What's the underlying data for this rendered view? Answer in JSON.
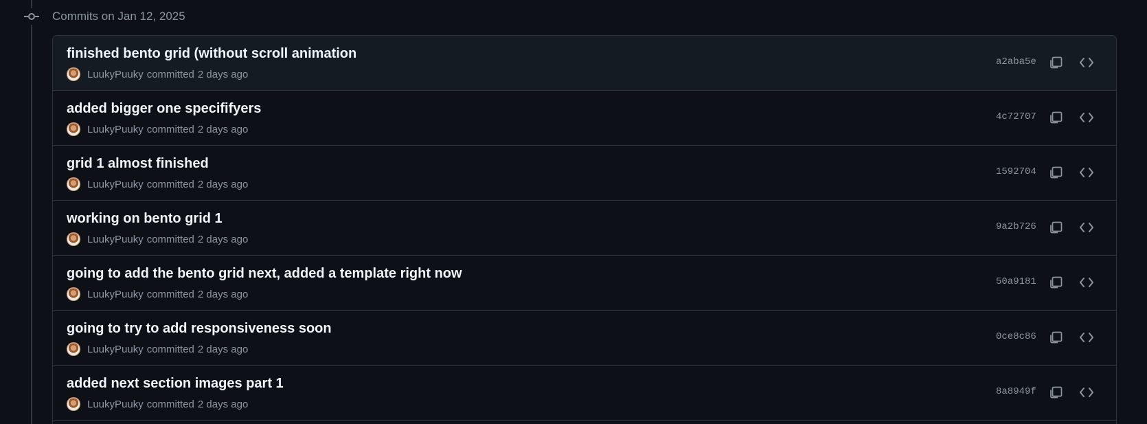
{
  "group": {
    "title": "Commits on Jan 12, 2025"
  },
  "colors": {
    "background": "#0d1117",
    "row_highlight": "#151b23",
    "border": "#30363d",
    "title_text": "#f0f6fc",
    "muted_text": "#8d96a0"
  },
  "icons": {
    "node": "git-commit-icon",
    "copy": "copy-icon",
    "browse": "code-icon"
  },
  "commits": [
    {
      "title": "finished bento grid (without scroll animation",
      "author": "LuukyPuuky",
      "action": "committed",
      "time": "2 days ago",
      "sha": "a2aba5e"
    },
    {
      "title": "added bigger one specififyers",
      "author": "LuukyPuuky",
      "action": "committed",
      "time": "2 days ago",
      "sha": "4c72707"
    },
    {
      "title": "grid 1 almost finished",
      "author": "LuukyPuuky",
      "action": "committed",
      "time": "2 days ago",
      "sha": "1592704"
    },
    {
      "title": "working on bento grid 1",
      "author": "LuukyPuuky",
      "action": "committed",
      "time": "2 days ago",
      "sha": "9a2b726"
    },
    {
      "title": "going to add the bento grid next, added a template right now",
      "author": "LuukyPuuky",
      "action": "committed",
      "time": "2 days ago",
      "sha": "50a9181"
    },
    {
      "title": "going to try to add responsiveness soon",
      "author": "LuukyPuuky",
      "action": "committed",
      "time": "2 days ago",
      "sha": "0ce8c86"
    },
    {
      "title": "added next section images part 1",
      "author": "LuukyPuuky",
      "action": "committed",
      "time": "2 days ago",
      "sha": "8a8949f"
    }
  ]
}
